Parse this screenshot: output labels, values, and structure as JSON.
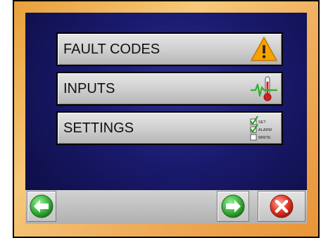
{
  "menu": {
    "items": [
      {
        "label": "FAULT CODES",
        "icon": "warning-icon"
      },
      {
        "label": "INPUTS",
        "icon": "thermometer-icon"
      },
      {
        "label": "SETTINGS",
        "icon": "checklist-icon",
        "icon_labels": [
          "SET",
          "ALARM",
          "WRITE"
        ]
      }
    ]
  },
  "nav": {
    "back_icon": "arrow-left-icon",
    "forward_icon": "arrow-right-icon",
    "close_icon": "close-icon"
  },
  "colors": {
    "screen_bg": "#1a1a6e",
    "frame": "#f0b060",
    "warning": "#f5a300",
    "nav_green": "#3fb83f",
    "close_red": "#e03a2a"
  }
}
